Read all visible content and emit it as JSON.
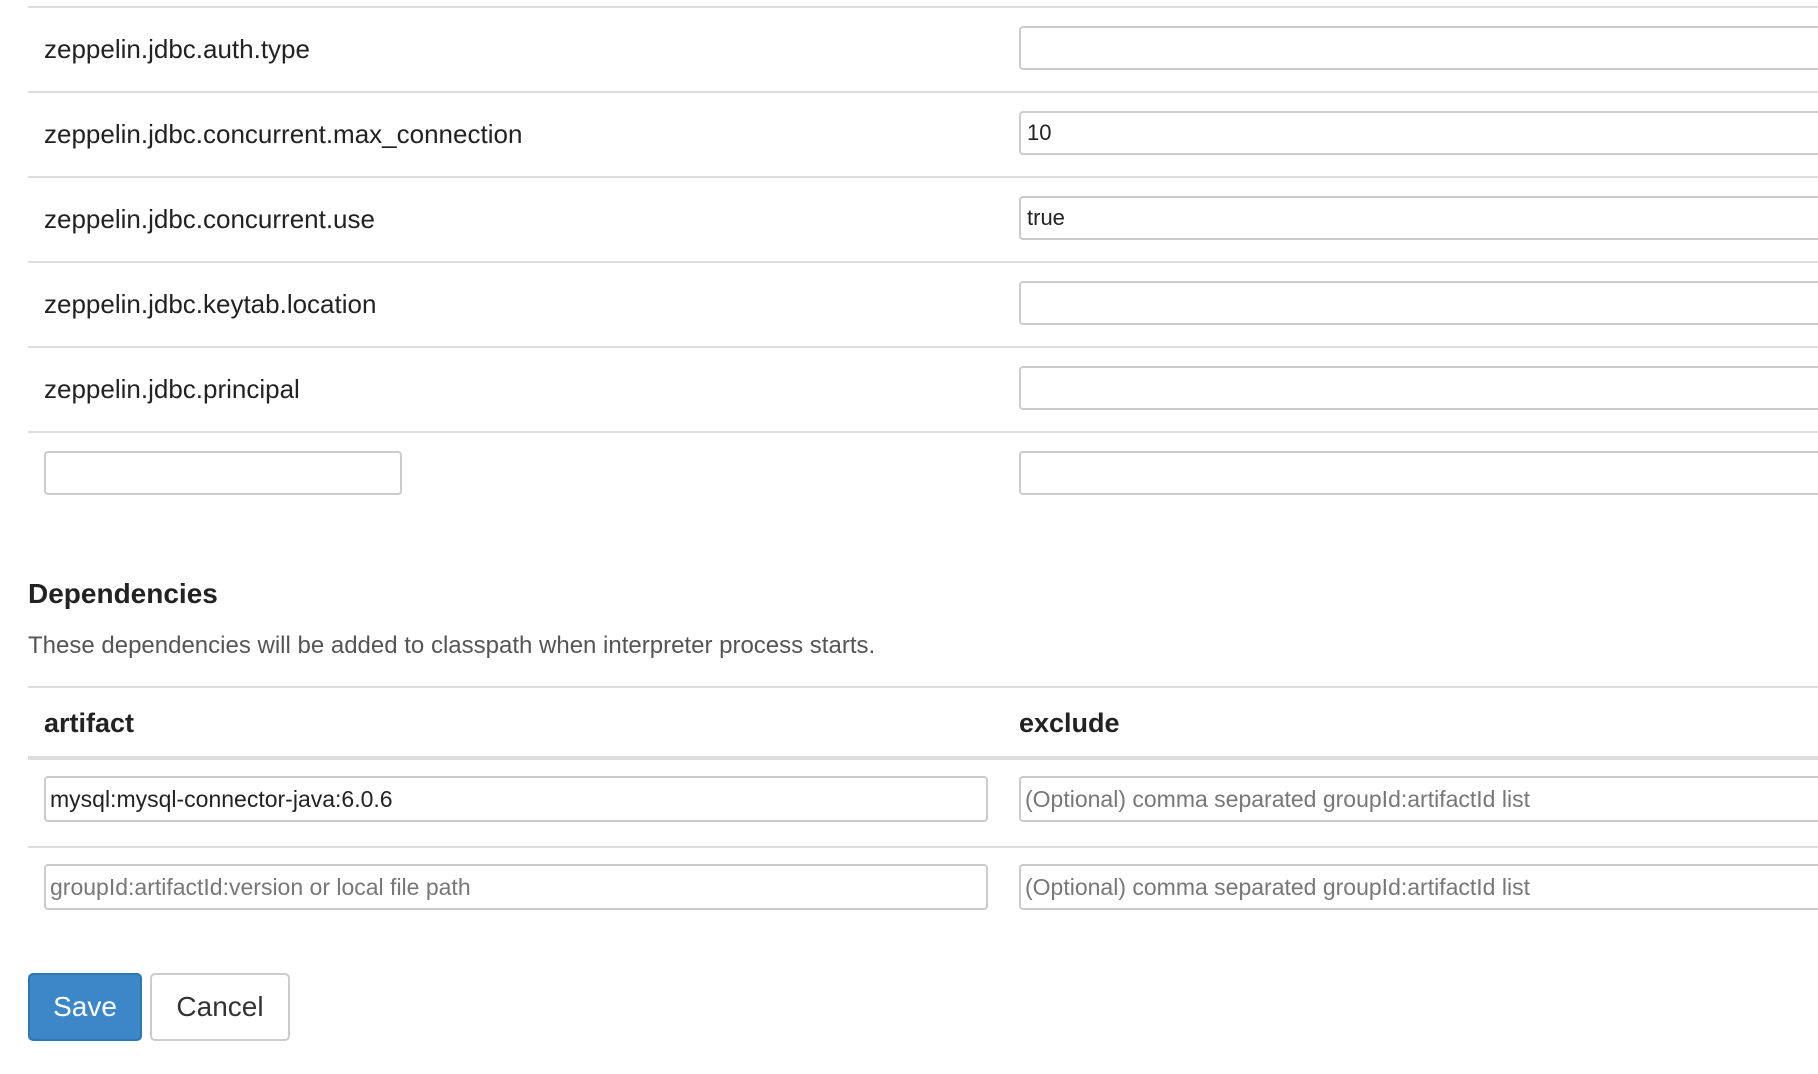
{
  "properties": [
    {
      "name": "zeppelin.jdbc.auth.type",
      "value": ""
    },
    {
      "name": "zeppelin.jdbc.concurrent.max_connection",
      "value": "10"
    },
    {
      "name": "zeppelin.jdbc.concurrent.use",
      "value": "true"
    },
    {
      "name": "zeppelin.jdbc.keytab.location",
      "value": ""
    },
    {
      "name": "zeppelin.jdbc.principal",
      "value": ""
    }
  ],
  "new_property": {
    "name_value": "",
    "value": ""
  },
  "dependencies": {
    "title": "Dependencies",
    "description": "These dependencies will be added to classpath when interpreter process starts.",
    "headers": {
      "artifact": "artifact",
      "exclude": "exclude"
    },
    "rows": [
      {
        "artifact": "mysql:mysql-connector-java:6.0.6",
        "artifact_placeholder": "",
        "exclude": "",
        "exclude_placeholder": "(Optional) comma separated groupId:artifactId list"
      }
    ],
    "new_row": {
      "artifact": "",
      "artifact_placeholder": "groupId:artifactId:version or local file path",
      "exclude": "",
      "exclude_placeholder": "(Optional) comma separated groupId:artifactId list"
    }
  },
  "actions": {
    "save_label": "Save",
    "cancel_label": "Cancel"
  },
  "colors": {
    "save_button": "#3b87c8",
    "border": "#dddddd"
  }
}
